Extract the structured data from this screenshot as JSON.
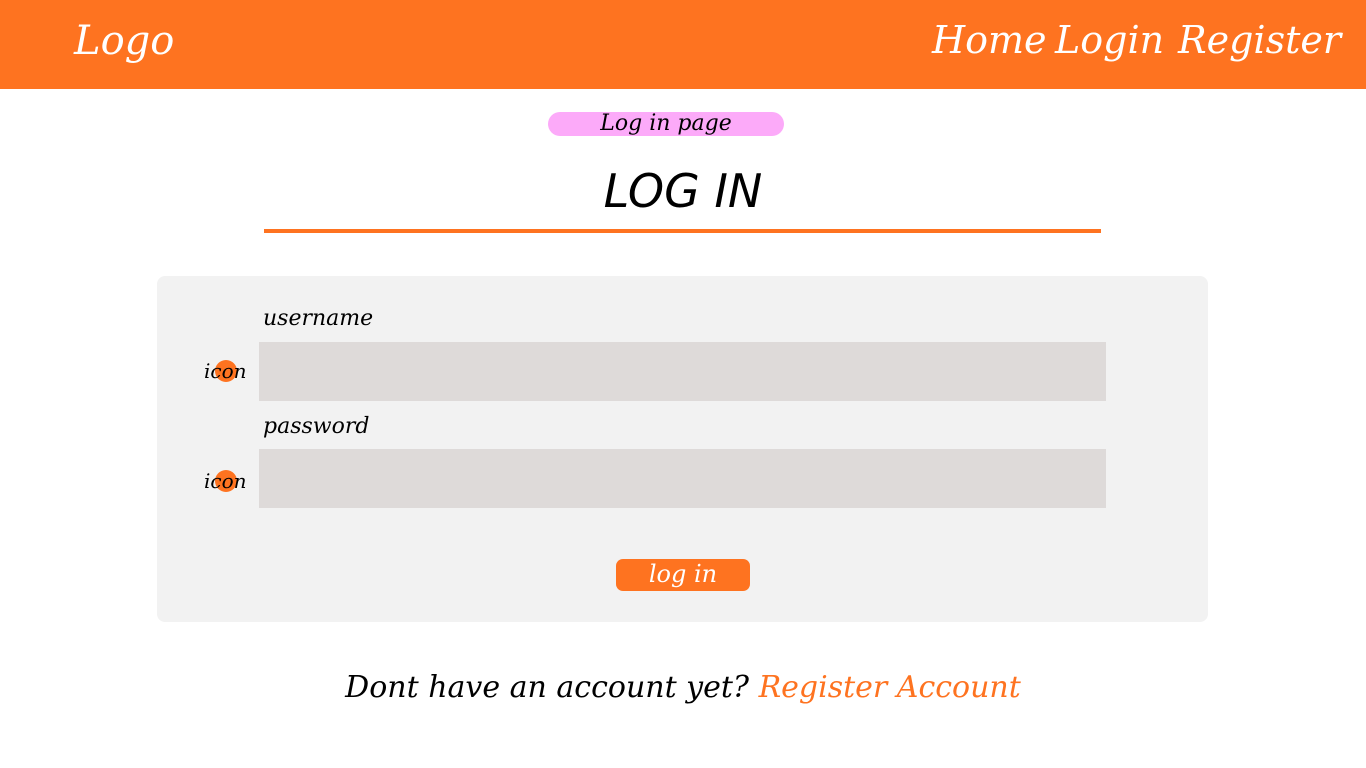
{
  "nav": {
    "logo": "Logo",
    "links": [
      "Home",
      "Login",
      "Register"
    ]
  },
  "page_tag": "Log in page",
  "title": "LOG IN",
  "form": {
    "username_label": "username",
    "password_label": "password",
    "icon_text": "icon",
    "username_value": "",
    "password_value": "",
    "submit_label": "log in"
  },
  "footer": {
    "prompt": "Dont have an account yet?",
    "link": "Register Account"
  },
  "colors": {
    "accent": "#fe7320",
    "tag": "#fcaaf9",
    "card": "#f2f2f2",
    "input": "#dedad9"
  }
}
